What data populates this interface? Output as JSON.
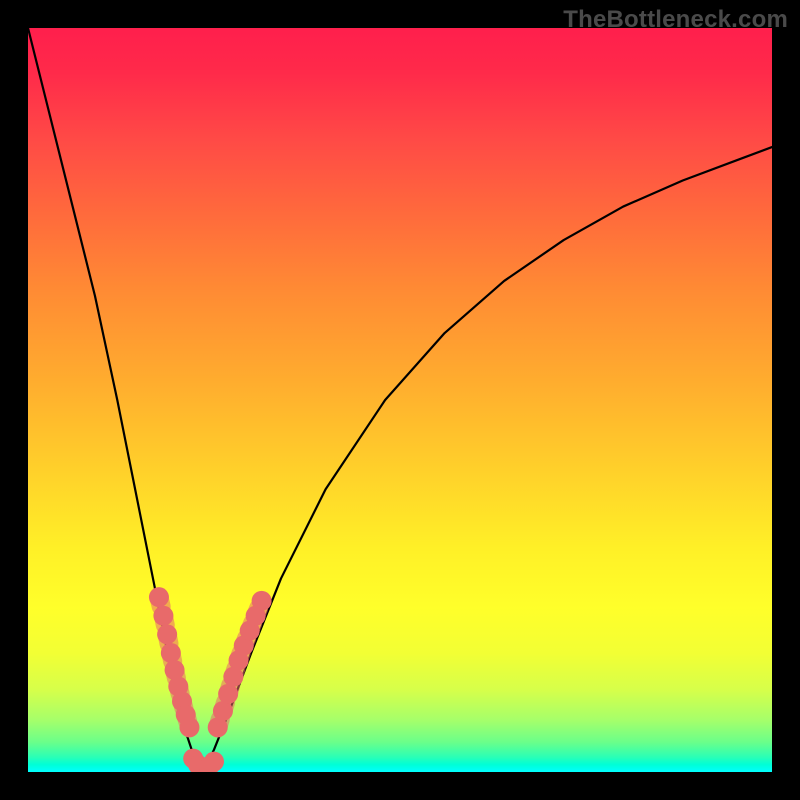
{
  "watermark": "TheBottleneck.com",
  "chart_data": {
    "type": "line",
    "title": "",
    "xlabel": "",
    "ylabel": "",
    "xlim": [
      0,
      100
    ],
    "ylim": [
      0,
      100
    ],
    "grid": false,
    "legend": false,
    "series": [
      {
        "name": "left-branch",
        "x": [
          0,
          3,
          6,
          9,
          12,
          14,
          16,
          18,
          19.5,
          21,
          22,
          23,
          23.5
        ],
        "y": [
          100,
          88,
          76,
          64,
          50,
          40,
          30,
          20,
          12,
          6,
          3,
          1,
          0
        ],
        "stroke": "#000000",
        "width": 2.2
      },
      {
        "name": "right-branch",
        "x": [
          23.5,
          25,
          27,
          30,
          34,
          40,
          48,
          56,
          64,
          72,
          80,
          88,
          96,
          100
        ],
        "y": [
          0,
          3,
          8,
          16,
          26,
          38,
          50,
          59,
          66,
          71.5,
          76,
          79.5,
          82.5,
          84
        ],
        "stroke": "#000000",
        "width": 2.2
      },
      {
        "name": "dotted-left",
        "x": [
          17.6,
          18.2,
          18.7,
          19.2,
          19.7,
          20.2,
          20.7,
          21.2,
          21.7
        ],
        "y": [
          23.5,
          21,
          18.5,
          16,
          13.7,
          11.5,
          9.5,
          7.7,
          6
        ],
        "stroke": "#e86a6a",
        "width": 10,
        "dotted": true
      },
      {
        "name": "dotted-right",
        "x": [
          25.5,
          26.2,
          26.9,
          27.6,
          28.3,
          29.0,
          29.8,
          30.6,
          31.4
        ],
        "y": [
          6,
          8.2,
          10.5,
          12.8,
          15,
          17,
          19,
          21,
          23
        ],
        "stroke": "#e86a6a",
        "width": 10,
        "dotted": true
      },
      {
        "name": "dotted-bottom",
        "x": [
          22.2,
          22.9,
          23.6,
          24.3,
          25.0
        ],
        "y": [
          1.8,
          0.9,
          0.5,
          0.7,
          1.4
        ],
        "stroke": "#e86a6a",
        "width": 10,
        "dotted": true
      }
    ],
    "annotations": []
  }
}
